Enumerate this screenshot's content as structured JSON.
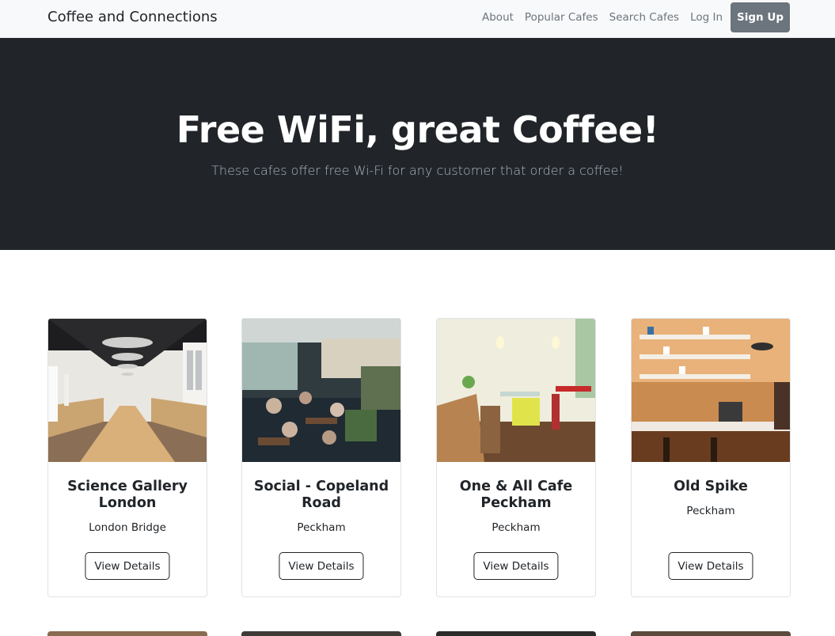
{
  "navbar": {
    "brand": "Coffee and Connections",
    "links": [
      "About",
      "Popular Cafes",
      "Search Cafes",
      "Log In"
    ],
    "signup_label": "Sign Up"
  },
  "hero": {
    "title": "Free WiFi, great Coffee!",
    "subtitle": "These cafes offer free Wi-Fi for any customer that order a coffee!"
  },
  "cafes": [
    {
      "name": "Science Gallery London",
      "location": "London Bridge",
      "button": "View Details"
    },
    {
      "name": "Social - Copeland Road",
      "location": "Peckham",
      "button": "View Details"
    },
    {
      "name": "One & All Cafe Peckham",
      "location": "Peckham",
      "button": "View Details"
    },
    {
      "name": "Old Spike",
      "location": "Peckham",
      "button": "View Details"
    }
  ],
  "colors": {
    "navbar_bg": "#f8f9fa",
    "hero_bg": "#212529",
    "signup_bg": "#6c757d"
  }
}
